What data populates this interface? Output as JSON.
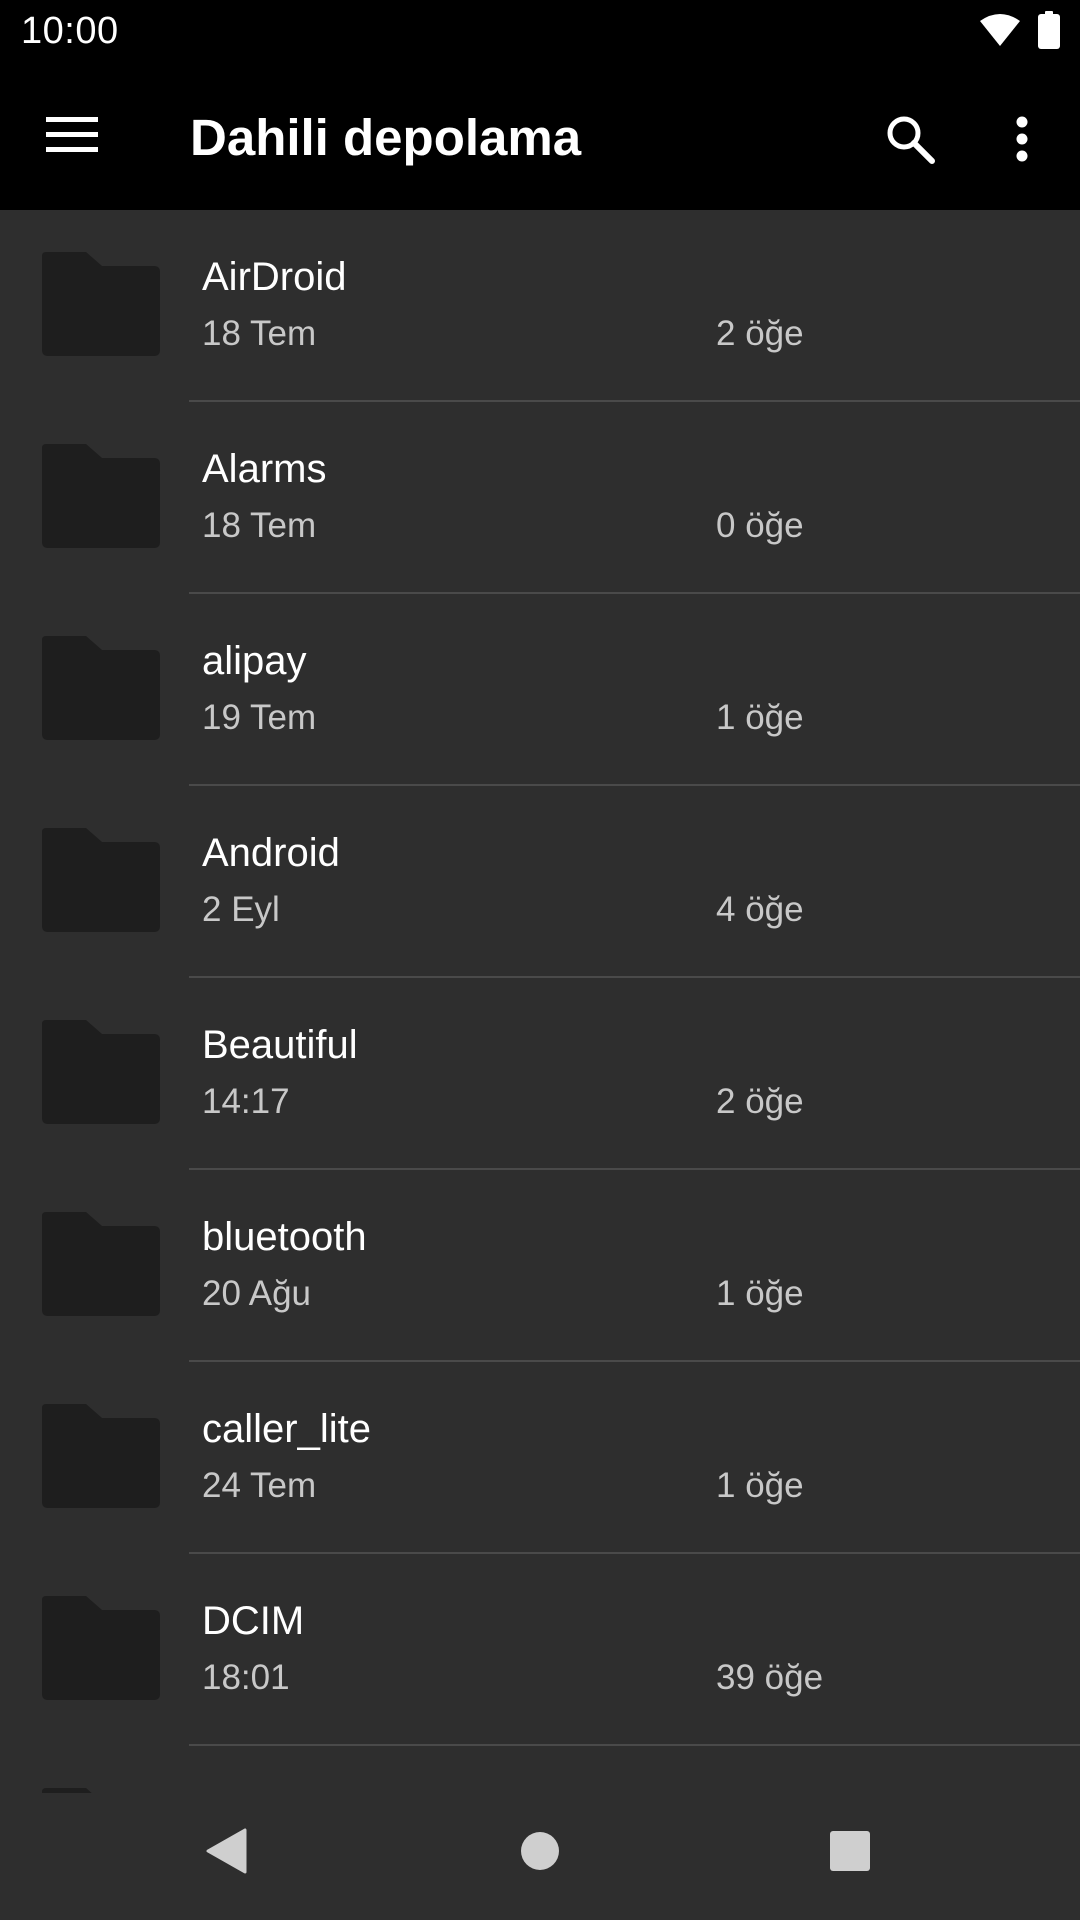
{
  "status_bar": {
    "time": "10:00",
    "icons": [
      "wifi-icon",
      "battery-icon"
    ]
  },
  "app_bar": {
    "title": "Dahili depolama",
    "icons": [
      "menu-icon",
      "search-icon",
      "more-vert-icon"
    ]
  },
  "files": [
    {
      "name": "AirDroid",
      "date": "18 Tem",
      "count": "2 öğe"
    },
    {
      "name": "Alarms",
      "date": "18 Tem",
      "count": "0 öğe"
    },
    {
      "name": "alipay",
      "date": "19 Tem",
      "count": "1 öğe"
    },
    {
      "name": "Android",
      "date": "2 Eyl",
      "count": "4 öğe"
    },
    {
      "name": "Beautiful",
      "date": "14:17",
      "count": "2 öğe"
    },
    {
      "name": "bluetooth",
      "date": "20 Ağu",
      "count": "1 öğe"
    },
    {
      "name": "caller_lite",
      "date": "24 Tem",
      "count": "1 öğe"
    },
    {
      "name": "DCIM",
      "date": "18:01",
      "count": "39 öğe"
    }
  ],
  "nav_bar": {
    "icons": [
      "back-icon",
      "home-icon",
      "recents-icon"
    ]
  },
  "colors": {
    "background": "#2e2e2e",
    "bar": "#000000",
    "folder": "#1e1e1e",
    "divider": "#4a4a4a",
    "secondary_text": "#c8c8c8"
  }
}
